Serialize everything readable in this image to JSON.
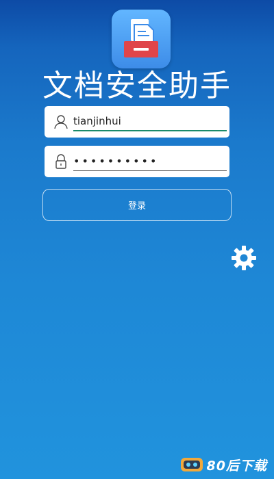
{
  "app": {
    "title": "文档安全助手",
    "icon_name": "document-tray-icon"
  },
  "login": {
    "username_value": "tianjinhui",
    "password_value": "••••••••••",
    "submit_label": "登录"
  },
  "icons": {
    "user": "user-icon",
    "lock": "lock-icon",
    "settings": "gear-icon"
  },
  "watermark": {
    "text": "80后下载"
  },
  "colors": {
    "background_top": "#0d4ba6",
    "background_bottom": "#2193dd",
    "accent_underline": "#1a8a6a",
    "icon_tray_red": "#e0454a"
  }
}
